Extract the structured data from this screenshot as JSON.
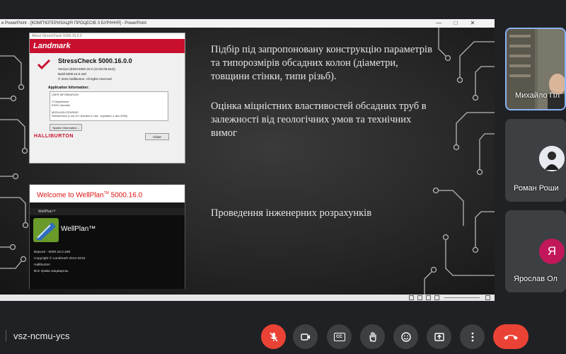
{
  "share": {
    "titlebar_text": "е PowerPoint - [КОМП'ЮТЕРИЗАЦІЯ ПРОЦЕСІВ З БУРІННЯ] - PowerPoint",
    "minimize": "—",
    "maximize": "□",
    "close": "✕"
  },
  "stresscheck": {
    "window_title": "About StressCheck 5000.16.0.0",
    "brand": "Landmark",
    "product": "StressCheck 5000.16.0.0",
    "version_line": "Version  (EDM 5000.16.0 (10.00.06.642))",
    "build_line": "Build 5000.16.0.420",
    "copyright_line": "© 2016 Halliburton. All rights reserved.",
    "app_info_label": "Application Information:",
    "app_info_lines": [
      "USER INFORMATION",
      "",
      "IT Department",
      "KSSC Ukrnafta",
      "",
      "MODULE/LICENSING",
      "StressCheck (1 out of 1 licenses in use - expiration 1-dec-2069)"
    ],
    "system_info_button": "System Information...",
    "close_button": "Close",
    "footer_brand": "HALLIBURTON"
  },
  "wellplan": {
    "welcome_prefix": "Welcome to WellPlan",
    "welcome_tm": "TM",
    "welcome_version": " 5000.16.0",
    "mini_title": "WellPlan™",
    "name": "WellPlan™",
    "version": "Версия -   5000.16.0.268",
    "copyright": "Copyright © Landmark 2014-2015",
    "company": "Halliburton",
    "rights": "Все права защищены."
  },
  "slide": {
    "para1": "Підбір під запропоновану конструкцію параметрів та типорозмірів обсадних колон (діаметри, товщини стінки, типи різьб).",
    "para2": "Оцінка міцністних властивостей обсадних труб в залежності від геологічних умов та технічних вимог",
    "para3": "Проведення інженерних розрахунків"
  },
  "participants": [
    {
      "name": "Михайло Пл",
      "initial": ""
    },
    {
      "name": "Роман Роши",
      "initial": ""
    },
    {
      "name": "Ярослав Ол",
      "initial": "Я",
      "avatar_color": "#c2185b"
    }
  ],
  "meeting": {
    "code": "vsz-ncmu-ycs"
  },
  "controls": {
    "mic": "mic-off-icon",
    "camera": "camera-icon",
    "captions": "CC",
    "hand": "raise-hand-icon",
    "emoji": "emoji-icon",
    "present": "present-icon",
    "more": "more-icon",
    "hangup": "hangup-icon"
  },
  "colors": {
    "accent_red": "#ea4335",
    "control_bg": "#3c4043",
    "active_border": "#8ab4f8"
  }
}
